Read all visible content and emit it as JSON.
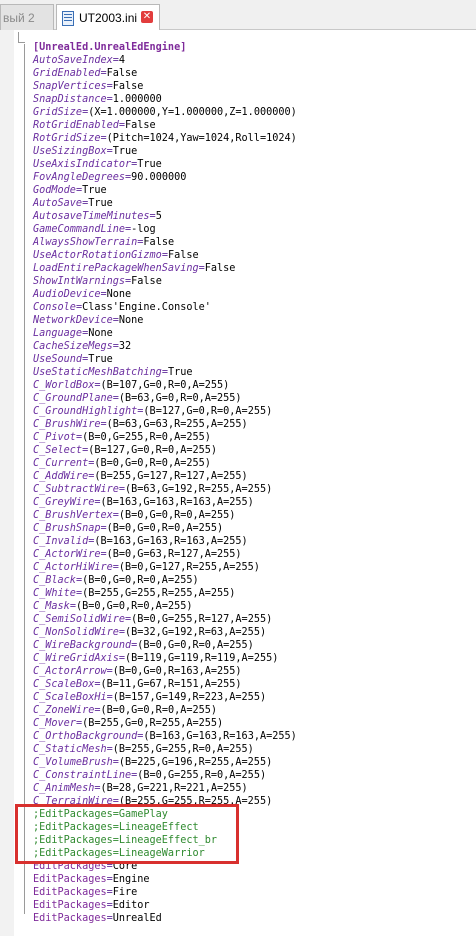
{
  "tabs": [
    {
      "label": "вый 2",
      "active": false
    },
    {
      "label": "UT2003.ini",
      "active": true
    }
  ],
  "icons": {
    "file": "file-icon",
    "close": "close-icon"
  },
  "colors": {
    "section": "#7e2a9a",
    "key": "#6b2fa0",
    "comment": "#2f8a2f",
    "highlight": "#d8302e"
  },
  "lines": [
    {
      "type": "section",
      "text": "[UnrealEd.UnrealEdEngine]"
    },
    {
      "type": "kv",
      "key": "AutoSaveIndex",
      "value": "4"
    },
    {
      "type": "kv",
      "key": "GridEnabled",
      "value": "False"
    },
    {
      "type": "kv",
      "key": "SnapVertices",
      "value": "False"
    },
    {
      "type": "kv",
      "key": "SnapDistance",
      "value": "1.000000"
    },
    {
      "type": "kv",
      "key": "GridSize",
      "value": "(X=1.000000,Y=1.000000,Z=1.000000)"
    },
    {
      "type": "kv",
      "key": "RotGridEnabled",
      "value": "False"
    },
    {
      "type": "kv",
      "key": "RotGridSize",
      "value": "(Pitch=1024,Yaw=1024,Roll=1024)"
    },
    {
      "type": "kv",
      "key": "UseSizingBox",
      "value": "True"
    },
    {
      "type": "kv",
      "key": "UseAxisIndicator",
      "value": "True"
    },
    {
      "type": "kv",
      "key": "FovAngleDegrees",
      "value": "90.000000"
    },
    {
      "type": "kv",
      "key": "GodMode",
      "value": "True"
    },
    {
      "type": "kv",
      "key": "AutoSave",
      "value": "True"
    },
    {
      "type": "kv",
      "key": "AutosaveTimeMinutes",
      "value": "5"
    },
    {
      "type": "kv",
      "key": "GameCommandLine",
      "value": "-log"
    },
    {
      "type": "kv",
      "key": "AlwaysShowTerrain",
      "value": "False"
    },
    {
      "type": "kv",
      "key": "UseActorRotationGizmo",
      "value": "False"
    },
    {
      "type": "kv",
      "key": "LoadEntirePackageWhenSaving",
      "value": "False"
    },
    {
      "type": "kv",
      "key": "ShowIntWarnings",
      "value": "False"
    },
    {
      "type": "kv",
      "key": "AudioDevice",
      "value": "None"
    },
    {
      "type": "kv",
      "key": "Console",
      "value": "Class'Engine.Console'"
    },
    {
      "type": "kv",
      "key": "NetworkDevice",
      "value": "None"
    },
    {
      "type": "kv",
      "key": "Language",
      "value": "None"
    },
    {
      "type": "kv",
      "key": "CacheSizeMegs",
      "value": "32"
    },
    {
      "type": "kv",
      "key": "UseSound",
      "value": "True"
    },
    {
      "type": "kv",
      "key": "UseStaticMeshBatching",
      "value": "True"
    },
    {
      "type": "kv",
      "key": "C_WorldBox",
      "value": "(B=107,G=0,R=0,A=255)"
    },
    {
      "type": "kv",
      "key": "C_GroundPlane",
      "value": "(B=63,G=0,R=0,A=255)"
    },
    {
      "type": "kv",
      "key": "C_GroundHighlight",
      "value": "(B=127,G=0,R=0,A=255)"
    },
    {
      "type": "kv",
      "key": "C_BrushWire",
      "value": "(B=63,G=63,R=255,A=255)"
    },
    {
      "type": "kv",
      "key": "C_Pivot",
      "value": "(B=0,G=255,R=0,A=255)"
    },
    {
      "type": "kv",
      "key": "C_Select",
      "value": "(B=127,G=0,R=0,A=255)"
    },
    {
      "type": "kv",
      "key": "C_Current",
      "value": "(B=0,G=0,R=0,A=255)"
    },
    {
      "type": "kv",
      "key": "C_AddWire",
      "value": "(B=255,G=127,R=127,A=255)"
    },
    {
      "type": "kv",
      "key": "C_SubtractWire",
      "value": "(B=63,G=192,R=255,A=255)"
    },
    {
      "type": "kv",
      "key": "C_GreyWire",
      "value": "(B=163,G=163,R=163,A=255)"
    },
    {
      "type": "kv",
      "key": "C_BrushVertex",
      "value": "(B=0,G=0,R=0,A=255)"
    },
    {
      "type": "kv",
      "key": "C_BrushSnap",
      "value": "(B=0,G=0,R=0,A=255)"
    },
    {
      "type": "kv",
      "key": "C_Invalid",
      "value": "(B=163,G=163,R=163,A=255)"
    },
    {
      "type": "kv",
      "key": "C_ActorWire",
      "value": "(B=0,G=63,R=127,A=255)"
    },
    {
      "type": "kv",
      "key": "C_ActorHiWire",
      "value": "(B=0,G=127,R=255,A=255)"
    },
    {
      "type": "kv",
      "key": "C_Black",
      "value": "(B=0,G=0,R=0,A=255)"
    },
    {
      "type": "kv",
      "key": "C_White",
      "value": "(B=255,G=255,R=255,A=255)"
    },
    {
      "type": "kv",
      "key": "C_Mask",
      "value": "(B=0,G=0,R=0,A=255)"
    },
    {
      "type": "kv",
      "key": "C_SemiSolidWire",
      "value": "(B=0,G=255,R=127,A=255)"
    },
    {
      "type": "kv",
      "key": "C_NonSolidWire",
      "value": "(B=32,G=192,R=63,A=255)"
    },
    {
      "type": "kv",
      "key": "C_WireBackground",
      "value": "(B=0,G=0,R=0,A=255)"
    },
    {
      "type": "kv",
      "key": "C_WireGridAxis",
      "value": "(B=119,G=119,R=119,A=255)"
    },
    {
      "type": "kv",
      "key": "C_ActorArrow",
      "value": "(B=0,G=0,R=163,A=255)"
    },
    {
      "type": "kv",
      "key": "C_ScaleBox",
      "value": "(B=11,G=67,R=151,A=255)"
    },
    {
      "type": "kv",
      "key": "C_ScaleBoxHi",
      "value": "(B=157,G=149,R=223,A=255)"
    },
    {
      "type": "kv",
      "key": "C_ZoneWire",
      "value": "(B=0,G=0,R=0,A=255)"
    },
    {
      "type": "kv",
      "key": "C_Mover",
      "value": "(B=255,G=0,R=255,A=255)"
    },
    {
      "type": "kv",
      "key": "C_OrthoBackground",
      "value": "(B=163,G=163,R=163,A=255)"
    },
    {
      "type": "kv",
      "key": "C_StaticMesh",
      "value": "(B=255,G=255,R=0,A=255)"
    },
    {
      "type": "kv",
      "key": "C_VolumeBrush",
      "value": "(B=225,G=196,R=255,A=255)"
    },
    {
      "type": "kv",
      "key": "C_ConstraintLine",
      "value": "(B=0,G=255,R=0,A=255)"
    },
    {
      "type": "kv",
      "key": "C_AnimMesh",
      "value": "(B=28,G=221,R=221,A=255)"
    },
    {
      "type": "kv",
      "key": "C_TerrainWire",
      "value": "(B=255,G=255,R=255,A=255)"
    },
    {
      "type": "comment",
      "text": ";EditPackages=GamePlay"
    },
    {
      "type": "comment",
      "text": ";EditPackages=LineageEffect"
    },
    {
      "type": "comment",
      "text": ";EditPackages=LineageEffect_br"
    },
    {
      "type": "comment",
      "text": ";EditPackages=LineageWarrior"
    },
    {
      "type": "pkv",
      "key": "EditPackages",
      "value": "Core"
    },
    {
      "type": "pkv",
      "key": "EditPackages",
      "value": "Engine"
    },
    {
      "type": "pkv",
      "key": "EditPackages",
      "value": "Fire"
    },
    {
      "type": "pkv",
      "key": "EditPackages",
      "value": "Editor"
    },
    {
      "type": "pkv",
      "key": "EditPackages",
      "value": "UnrealEd"
    }
  ]
}
